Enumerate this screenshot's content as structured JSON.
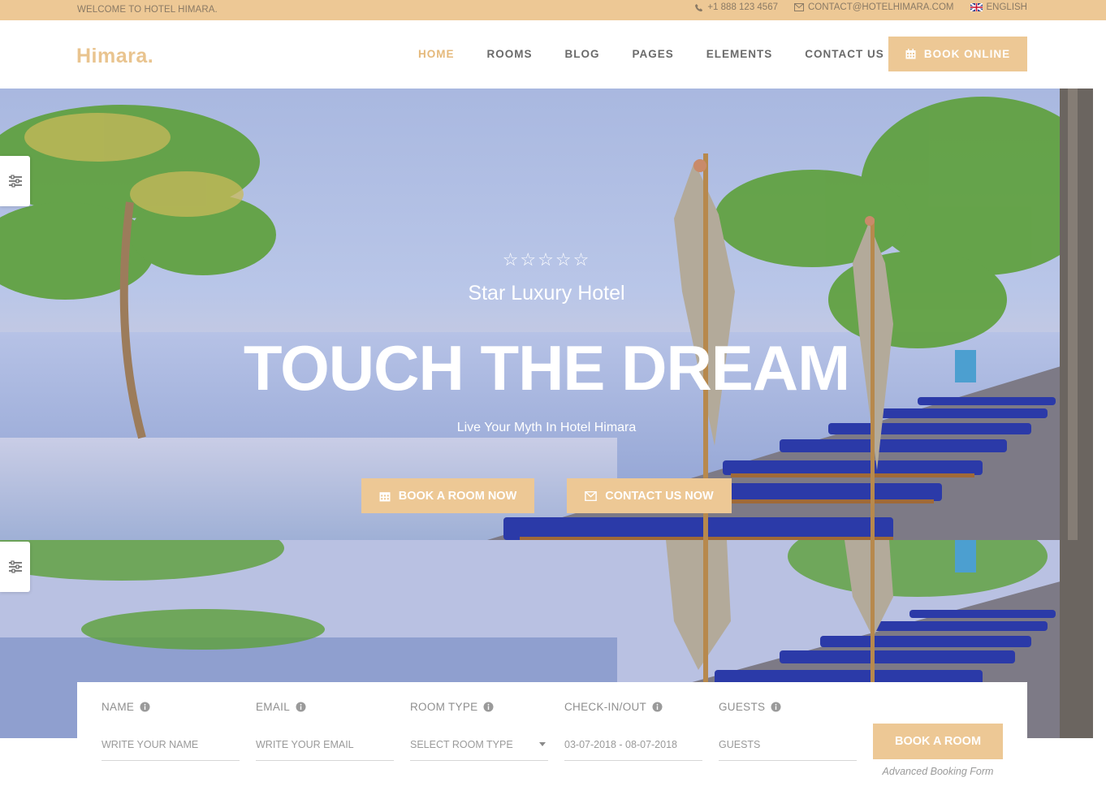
{
  "topbar": {
    "welcome": "WELCOME TO HOTEL HIMARA.",
    "phone": "+1 888 123 4567",
    "email": "CONTACT@HOTELHIMARA.COM",
    "language": "ENGLISH"
  },
  "header": {
    "logo": "Himara.",
    "nav": [
      "HOME",
      "ROOMS",
      "BLOG",
      "PAGES",
      "ELEMENTS",
      "CONTACT US"
    ],
    "active": "HOME",
    "book_online": "BOOK ONLINE"
  },
  "hero": {
    "stars": "☆☆☆☆☆",
    "subtitle": "Star Luxury Hotel",
    "title": "TOUCH THE DREAM",
    "tagline": "Live Your Myth In Hotel Himara",
    "btn_book": "BOOK A ROOM NOW",
    "btn_contact": "CONTACT US NOW"
  },
  "booking": {
    "name_label": "NAME",
    "name_placeholder": "WRITE YOUR NAME",
    "email_label": "EMAIL",
    "email_placeholder": "WRITE YOUR EMAIL",
    "room_label": "ROOM TYPE",
    "room_value": "SELECT ROOM TYPE",
    "dates_label": "CHECK-IN/OUT",
    "dates_value": "03-07-2018 - 08-07-2018",
    "guests_label": "GUESTS",
    "guests_placeholder": "GUESTS",
    "submit": "BOOK A ROOM",
    "caption": "Advanced Booking Form"
  },
  "colors": {
    "accent": "#edc895",
    "text": "#6a6a6a",
    "active": "#e5b97b"
  }
}
